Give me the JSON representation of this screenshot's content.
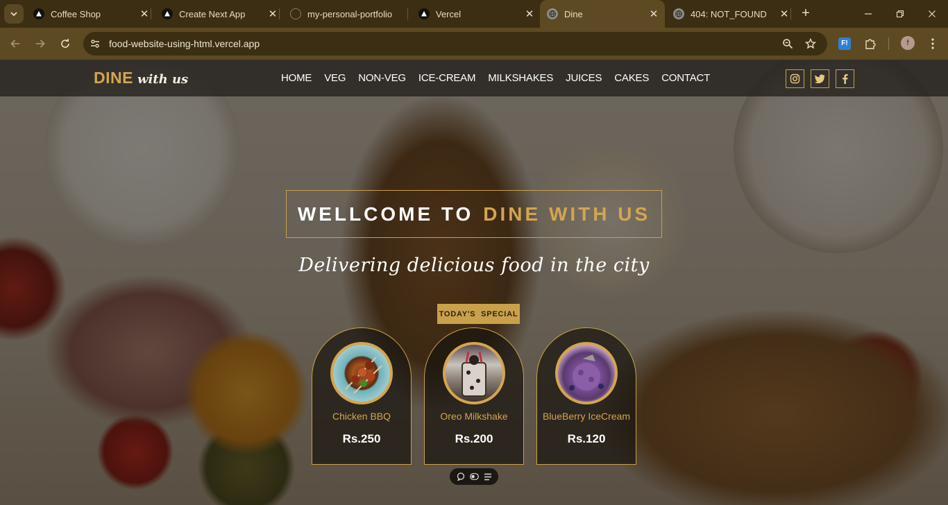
{
  "browser": {
    "tabs": [
      {
        "title": "Coffee Shop",
        "favicon": "vercel-triangle-icon",
        "active": false
      },
      {
        "title": "Create Next App",
        "favicon": "vercel-triangle-icon",
        "active": false
      },
      {
        "title": "my-personal-portfolio",
        "favicon": "github-icon",
        "active": false
      },
      {
        "title": "Vercel",
        "favicon": "vercel-triangle-icon",
        "active": false
      },
      {
        "title": "Dine",
        "favicon": "globe-icon",
        "active": true
      },
      {
        "title": "404: NOT_FOUND",
        "favicon": "globe-icon",
        "active": false
      }
    ],
    "url": "food-website-using-html.vercel.app",
    "profile_initial": "f",
    "extension_label": "F!"
  },
  "site": {
    "logo_main": "DINE",
    "logo_script": "with us",
    "nav": [
      "HOME",
      "VEG",
      "NON-VEG",
      "ICE-CREAM",
      "MILKSHAKES",
      "JUICES",
      "CAKES",
      "CONTACT"
    ],
    "social": [
      "instagram-icon",
      "twitter-icon",
      "facebook-icon"
    ],
    "hero_title_white": "WELLCOME TO",
    "hero_title_gold": "DINE WITH US",
    "tagline": "Delivering delicious food in the city",
    "special_label": "TODAY'S  SPECIAL",
    "specials": [
      {
        "name": "Chicken BBQ",
        "price": "Rs.250"
      },
      {
        "name": "Oreo Milkshake",
        "price": "Rs.200"
      },
      {
        "name": "BlueBerry IceCream",
        "price": "Rs.120"
      }
    ]
  },
  "colors": {
    "accent_gold": "#c9a14a",
    "browser_frame": "#3b2e12",
    "browser_toolbar": "#5d4a22"
  }
}
